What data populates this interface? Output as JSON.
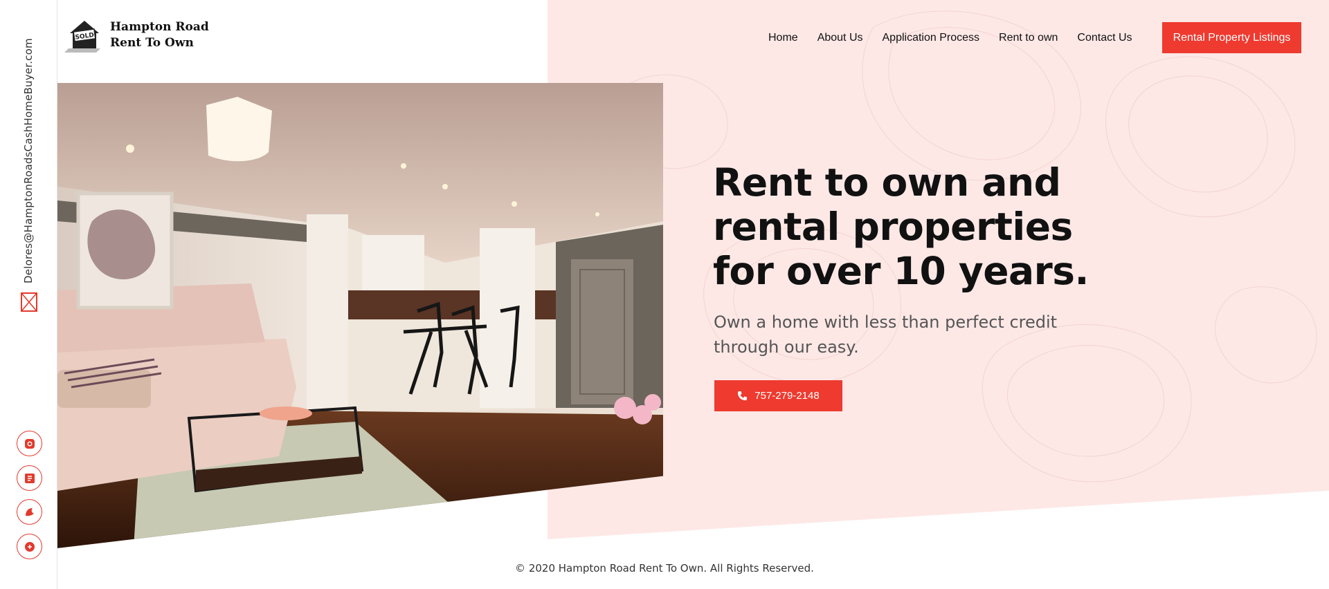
{
  "brand": {
    "name_line1": "Hampton Road",
    "name_line2": "Rent To Own",
    "logo_badge": "SOLD"
  },
  "rail": {
    "email": "Delores@HamptonRoadsCashHomeBuyer.com",
    "socials": [
      "instagram-icon",
      "blog-icon",
      "trulia-icon",
      "google-plus-icon"
    ]
  },
  "nav": {
    "items": [
      "Home",
      "About Us",
      "Application Process",
      "Rent to own",
      "Contact Us"
    ],
    "cta": "Rental Property Listings"
  },
  "hero": {
    "headline": "Rent to own and rental properties for over 10 years.",
    "subline": "Own a home with less than perfect credit through our easy.",
    "phone": "757-279-2148"
  },
  "footer": {
    "copyright": "© 2020 Hampton Road Rent To Own. All Rights Reserved."
  },
  "colors": {
    "accent": "#ee3a2f",
    "pink_bg": "#fde8e6",
    "text": "#111111"
  }
}
